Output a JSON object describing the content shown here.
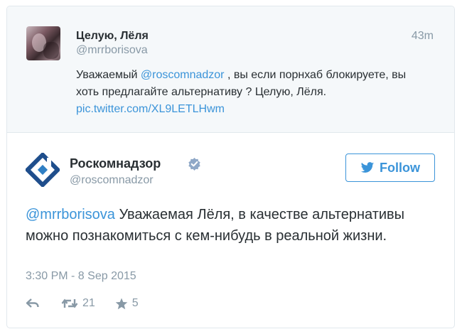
{
  "parent_tweet": {
    "name": "Целую, Лёля",
    "handle": "@mrrborisova",
    "time": "43m",
    "text_prefix": "Уважаемый ",
    "mention": "@roscomnadzor",
    "text_middle": " , вы если порнхаб блокируете, вы хоть предлагайте альтернативу ? Целую, Лёля. ",
    "link": "pic.twitter.com/XL9LETLHwm"
  },
  "main_tweet": {
    "name": "Роскомнадзор",
    "handle": "@roscomnadzor",
    "follow_label": "Follow",
    "mention": "@mrrborisova",
    "text": " Уважаемая Лёля, в качестве альтернативы можно познакомиться с кем-нибудь в реальной жизни.",
    "timestamp": "3:30 PM - 8 Sep 2015",
    "retweet_count": "21",
    "favorite_count": "5"
  },
  "colors": {
    "link": "#3b94d9",
    "muted": "#8899a6",
    "text": "#292f33",
    "parent_bg": "#f5f8fa",
    "logo_blue": "#1f4e8c"
  },
  "icons": {
    "verified": "verified-badge-icon",
    "follow": "bird-icon",
    "reply": "reply-icon",
    "retweet": "retweet-icon",
    "favorite": "star-icon"
  }
}
